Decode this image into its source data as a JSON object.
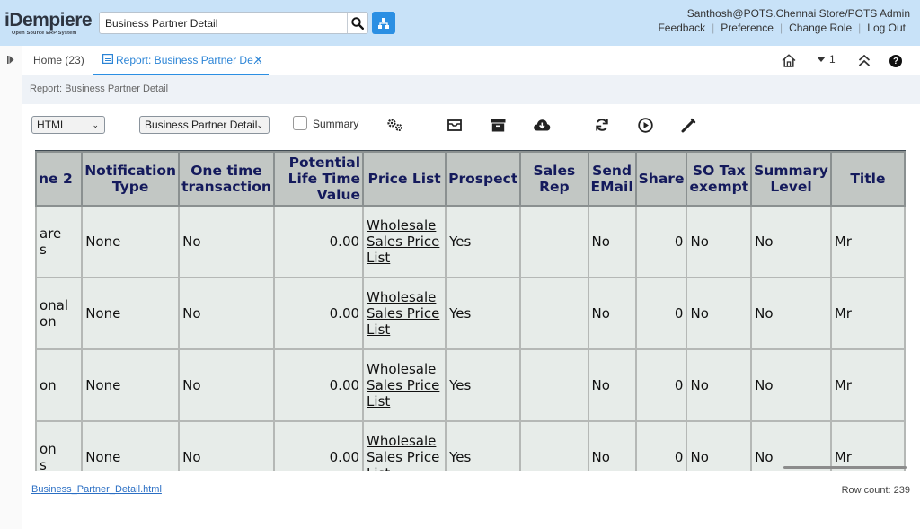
{
  "app": {
    "logo_text": "iDempiere",
    "logo_sub": "Open Source ERP System",
    "search_value": "Business Partner Detail",
    "user": "Santhosh@POTS.Chennai Store/POTS Admin",
    "links": {
      "feedback": "Feedback",
      "preference": "Preference",
      "change_role": "Change Role",
      "logout": "Log Out"
    }
  },
  "tabs": {
    "home": "Home (23)",
    "report": "Report: Business Partner De...",
    "close": "✕",
    "tab_count": "1"
  },
  "breadcrumb": "Report: Business Partner Detail",
  "toolbar": {
    "format_value": "HTML",
    "printformat_value": "Business Partner Detail",
    "summary_label": "Summary",
    "summary_checked": false
  },
  "table": {
    "headers": {
      "name2": "ne 2",
      "notification": "Notification Type",
      "onetime": "One time transaction",
      "potential": "Potential Life Time Value",
      "pricelist": "Price List",
      "prospect": "Prospect",
      "salesrep": "Sales Rep",
      "sendemail": "Send EMail",
      "share": "Share",
      "sotax": "SO Tax exempt",
      "summary": "Summary Level",
      "title": "Title"
    },
    "rows": [
      {
        "name2_a": "are",
        "name2_b": "s",
        "notification": "None",
        "onetime": "No",
        "potential": "0.00",
        "pricelist": "Wholesale Sales Price List",
        "prospect": "Yes",
        "salesrep": "",
        "sendemail": "No",
        "share": "0",
        "sotax": "No",
        "summary": "No",
        "title": "Mr"
      },
      {
        "name2_a": "onal",
        "name2_b": "on",
        "notification": "None",
        "onetime": "No",
        "potential": "0.00",
        "pricelist": "Wholesale Sales Price List",
        "prospect": "Yes",
        "salesrep": "",
        "sendemail": "No",
        "share": "0",
        "sotax": "No",
        "summary": "No",
        "title": "Mr"
      },
      {
        "name2_a": "",
        "name2_b": "on",
        "notification": "None",
        "onetime": "No",
        "potential": "0.00",
        "pricelist": "Wholesale Sales Price List",
        "prospect": "Yes",
        "salesrep": "",
        "sendemail": "No",
        "share": "0",
        "sotax": "No",
        "summary": "No",
        "title": "Mr"
      },
      {
        "name2_a": "on",
        "name2_b": "s",
        "notification": "None",
        "onetime": "No",
        "potential": "0.00",
        "pricelist": "Wholesale Sales Price List",
        "prospect": "Yes",
        "salesrep": "",
        "sendemail": "No",
        "share": "0",
        "sotax": "No",
        "summary": "No",
        "title": "Mr"
      }
    ]
  },
  "footer": {
    "file_link": "Business_Partner_Detail.html",
    "row_count": "Row count: 239"
  },
  "colors": {
    "header_bg": "#c8e2f8",
    "accent": "#2b8fe3",
    "table_header_bg": "#c2c7c4",
    "table_header_text": "#141a5c",
    "table_cell_bg": "#e7ece9"
  },
  "icons": [
    "search-icon",
    "tree-icon",
    "west-collapse-icon",
    "report-tab-icon",
    "home-icon",
    "chevron-down-icon",
    "maximize-icon",
    "help-icon",
    "customize-icon",
    "email-icon",
    "archive-icon",
    "download-icon",
    "refresh-icon",
    "run-icon",
    "wizard-icon"
  ]
}
